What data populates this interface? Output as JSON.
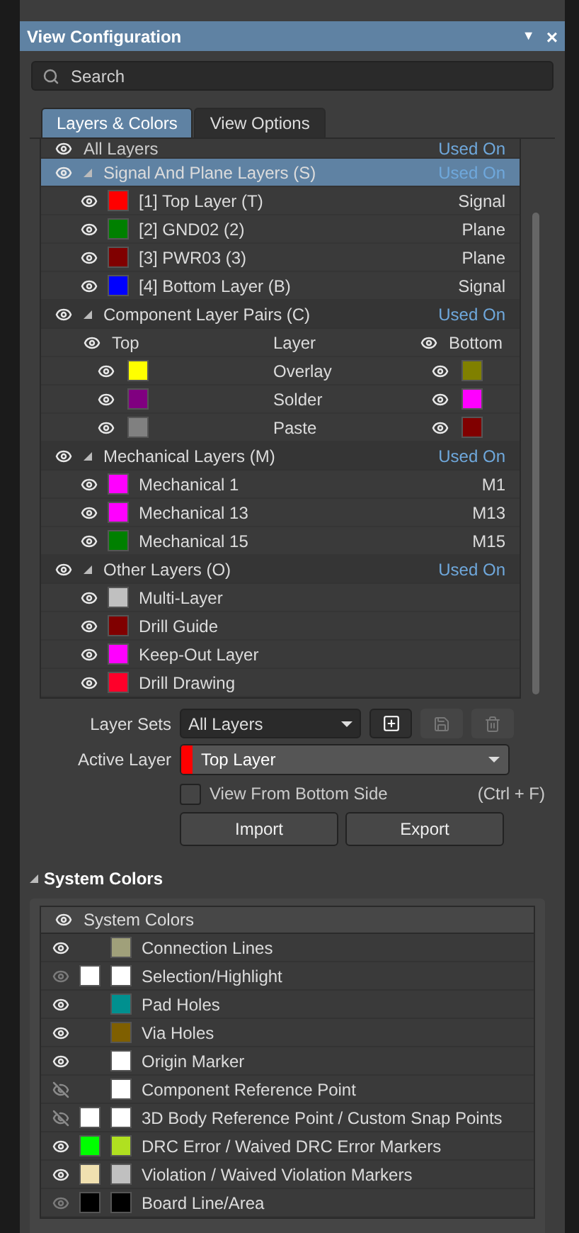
{
  "window": {
    "title": "View Configuration",
    "menu_glyph": "▼",
    "close_glyph": "×"
  },
  "search": {
    "placeholder": "Search"
  },
  "tabs": [
    {
      "label": "Layers & Colors",
      "selected": true
    },
    {
      "label": "View Options",
      "selected": false
    }
  ],
  "all_layers": {
    "label": "All Layers",
    "used_on": "Used On"
  },
  "groups": [
    {
      "kind": "layers",
      "title": "Signal And Plane Layers (S)",
      "used_on": "Used On",
      "selected": true,
      "expanded": true,
      "items": [
        {
          "name": "[1] Top Layer (T)",
          "color": "#ff0000",
          "type": "Signal"
        },
        {
          "name": "[2] GND02 (2)",
          "color": "#008000",
          "type": "Plane"
        },
        {
          "name": "[3] PWR03 (3)",
          "color": "#800000",
          "type": "Plane"
        },
        {
          "name": "[4] Bottom Layer (B)",
          "color": "#0000ff",
          "type": "Signal"
        }
      ]
    },
    {
      "kind": "pairs",
      "title": "Component Layer Pairs (C)",
      "used_on": "Used On",
      "selected": false,
      "expanded": true,
      "columns": {
        "top": "Top",
        "layer": "Layer",
        "bottom": "Bottom"
      },
      "items": [
        {
          "name": "Overlay",
          "top": {
            "color": "#ffff00"
          },
          "bottom": {
            "color": "#808000"
          }
        },
        {
          "name": "Solder",
          "top": {
            "color": "#800080"
          },
          "bottom": {
            "color": "#ff00ff"
          }
        },
        {
          "name": "Paste",
          "top": {
            "color": "#808080"
          },
          "bottom": {
            "color": "#800000"
          }
        }
      ]
    },
    {
      "kind": "layers",
      "title": "Mechanical Layers (M)",
      "used_on": "Used On",
      "selected": false,
      "expanded": true,
      "items": [
        {
          "name": "Mechanical 1",
          "color": "#ff00ff",
          "type": "M1"
        },
        {
          "name": "Mechanical 13",
          "color": "#ff00ff",
          "type": "M13"
        },
        {
          "name": "Mechanical 15",
          "color": "#008000",
          "type": "M15"
        }
      ]
    },
    {
      "kind": "layers",
      "title": "Other Layers (O)",
      "used_on": "Used On",
      "selected": false,
      "expanded": true,
      "items": [
        {
          "name": "Multi-Layer",
          "color": "#c0c0c0"
        },
        {
          "name": "Drill Guide",
          "color": "#800000"
        },
        {
          "name": "Keep-Out Layer",
          "color": "#ff00ff"
        },
        {
          "name": "Drill Drawing",
          "color": "#ff002a"
        }
      ]
    }
  ],
  "layer_sets": {
    "label": "Layer Sets",
    "value": "All Layers"
  },
  "active_layer": {
    "label": "Active Layer",
    "value": "Top Layer",
    "color": "#ff0000"
  },
  "view_from_bottom": {
    "label": "View From Bottom Side",
    "shortcut": "(Ctrl + F)",
    "checked": false
  },
  "buttons": [
    "Import",
    "Export"
  ],
  "system_colors": {
    "title": "System Colors",
    "expanded": true,
    "header": "System Colors",
    "items": [
      {
        "name": "Connection Lines",
        "visible": true,
        "dimmed": false,
        "color": "#a0a07a"
      },
      {
        "name": "Selection/Highlight",
        "visible": true,
        "dimmed": true,
        "second": {
          "color": "#ffffff"
        },
        "color": "#ffffff"
      },
      {
        "name": "Pad Holes",
        "visible": true,
        "dimmed": false,
        "color": "#00908f"
      },
      {
        "name": "Via Holes",
        "visible": true,
        "dimmed": false,
        "color": "#7f5f00"
      },
      {
        "name": "Origin Marker",
        "visible": true,
        "dimmed": false,
        "color": "#ffffff"
      },
      {
        "name": "Component Reference Point",
        "visible": false,
        "dimmed": false,
        "color": "#ffffff"
      },
      {
        "name": "3D Body Reference Point / Custom Snap Points",
        "visible": false,
        "dimmed": false,
        "second": {
          "color": "#ffffff"
        },
        "color": "#ffffff"
      },
      {
        "name": "DRC Error / Waived DRC Error Markers",
        "visible": true,
        "dimmed": false,
        "second": {
          "color": "#00ff00"
        },
        "color": "#b0e020"
      },
      {
        "name": "Violation / Waived Violation Markers",
        "visible": true,
        "dimmed": false,
        "second": {
          "color": "#f0e0b0"
        },
        "color": "#c0c0c0"
      },
      {
        "name": "Board Line/Area",
        "visible": true,
        "dimmed": true,
        "second": {
          "color": "#000000"
        },
        "color": "#000000"
      }
    ]
  }
}
